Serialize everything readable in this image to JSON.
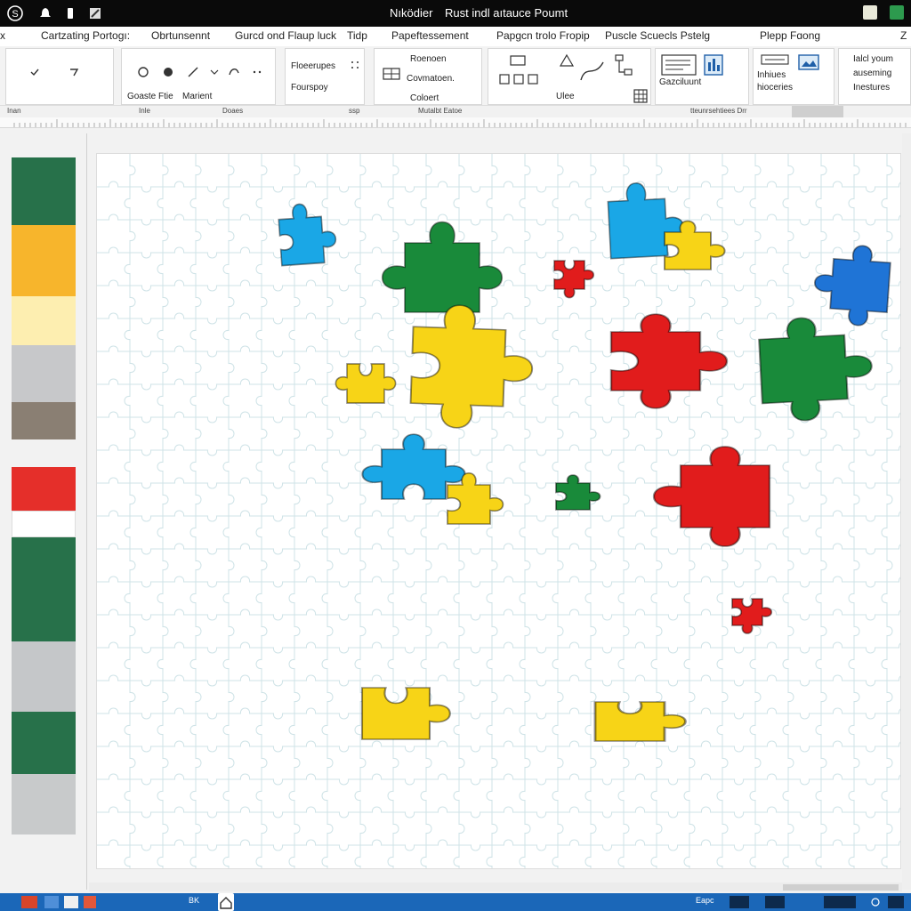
{
  "window": {
    "title_part1": "Nıködier",
    "title_part2": "Rust indl aıtauce Poumt"
  },
  "tabs": [
    {
      "label": "x"
    },
    {
      "label": "Cartzating Portogı:"
    },
    {
      "label": "Obrtunsennt"
    },
    {
      "label": "Gurcd ond Flaup luck"
    },
    {
      "label": "Tidp"
    },
    {
      "label": "Papeftessement"
    },
    {
      "label": "Papgcn trolo Fropip"
    },
    {
      "label": "Puscle Scuecls Pstelg"
    },
    {
      "label": "Plepp Fɑong"
    },
    {
      "label": "Z"
    }
  ],
  "ribbon": {
    "group2": {
      "label1": "Goaste Ftie",
      "label2": "Marient"
    },
    "group3": {
      "line1": "Floeerupes",
      "line2": "Fourspoy"
    },
    "group4": {
      "line1": "Roenoen",
      "line2": "Covmatoen.",
      "line3": "Coloert"
    },
    "group5": {
      "label": "Ulee"
    },
    "group6": {
      "label": "Gazciluunt"
    },
    "group7": {
      "line1": "Inhiues",
      "line2": "hioceries"
    },
    "group8": {
      "line1": "Ialcl youm",
      "line2": "auseming",
      "line3": "Inestures"
    },
    "foot": [
      "Inan",
      "Inle",
      "Doaes",
      "ssp",
      "Mutalbt Eatoe",
      "tteunrsehtiees Drr"
    ]
  },
  "swatches": {
    "dark_green": "#27714a",
    "amber": "#f7b52c",
    "cream": "#fdeeb0",
    "light_gray": "#c7c8ca",
    "taupe": "#8a7f73",
    "red": "#e52f2a",
    "white": "#ffffff",
    "gray2": "#c5c7c9",
    "gray3": "#c8cacb"
  },
  "pieces": {
    "blue": "#1aa7e6",
    "royal_blue": "#1f74d6",
    "green": "#198a3a",
    "yellow": "#f7d417",
    "red": "#e11c1c"
  },
  "taskbar": {
    "item1": "BK",
    "item2": "Eapc"
  }
}
